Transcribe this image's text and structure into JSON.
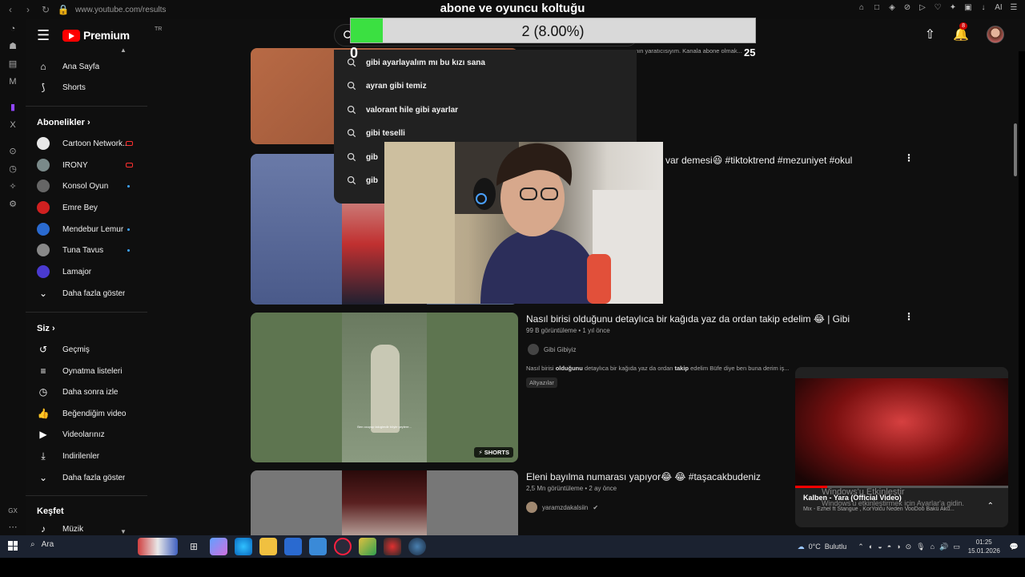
{
  "browser": {
    "url": "www.youtube.com/results",
    "back": "‹",
    "forward": "›",
    "reload": "↻",
    "ext_label": "AI"
  },
  "overlay": {
    "title": "abone ve oyuncu koltuğu",
    "goal_text": "2 (8.00%)",
    "goal_progress": 0.08,
    "goal_min": "0",
    "goal_max": "25"
  },
  "header": {
    "brand": "Premium",
    "country": "TR",
    "notification_count": "8"
  },
  "sidebar": {
    "main": [
      {
        "label": "Ana Sayfa",
        "icon": "home-icon"
      },
      {
        "label": "Shorts",
        "icon": "shorts-icon"
      }
    ],
    "subscriptions_heading": "Abonelikler",
    "subscriptions": [
      {
        "label": "Cartoon Network...",
        "color": "#e8e8e8",
        "indicator": "live"
      },
      {
        "label": "IRONY",
        "color": "#7a8a8a",
        "indicator": "live"
      },
      {
        "label": "Konsol Oyun",
        "color": "#666666",
        "indicator": "dot"
      },
      {
        "label": "Emre Bey",
        "color": "#d02020",
        "indicator": ""
      },
      {
        "label": "Mendebur Lemur",
        "color": "#2a6ad0",
        "indicator": "dot"
      },
      {
        "label": "Tuna Tavus",
        "color": "#888888",
        "indicator": "dot"
      },
      {
        "label": "Lamajor",
        "color": "#4a3ad0",
        "indicator": ""
      }
    ],
    "show_more": "Daha fazla göster",
    "you_heading": "Siz",
    "you": [
      {
        "label": "Geçmiş",
        "icon": "history-icon"
      },
      {
        "label": "Oynatma listeleri",
        "icon": "playlist-icon"
      },
      {
        "label": "Daha sonra izle",
        "icon": "clock-icon"
      },
      {
        "label": "Beğendiğim videolar",
        "icon": "thumbs-up-icon"
      },
      {
        "label": "Videolarınız",
        "icon": "your-videos-icon"
      },
      {
        "label": "İndirilenler",
        "icon": "download-icon"
      },
      {
        "label": "Daha fazla göster",
        "icon": "chevron-down-icon"
      }
    ],
    "explore_heading": "Keşfet",
    "explore": [
      {
        "label": "Müzik",
        "icon": "music-icon"
      }
    ]
  },
  "search": {
    "suggestions": [
      {
        "bold": "gibi ayarlayalım mı bu kızı sana",
        "thin": ""
      },
      {
        "bold": "ayran gibi temiz",
        "thin": ""
      },
      {
        "bold": "valorant hile gibi ayarlar",
        "thin": ""
      },
      {
        "bold": "gibi teselli",
        "thin": ""
      },
      {
        "bold": "gib",
        "thin": ""
      },
      {
        "bold": "gib",
        "thin": ""
      }
    ]
  },
  "results": {
    "top_partial_desc": "nın yaratıcısıyım. Kanala abone olmak...",
    "video1": {
      "title": "u var demesi😆 #tiktoktrend #mezuniyet #okul"
    },
    "video2": {
      "title": "Nasıl birisi olduğunu detaylıca bir kağıda yaz da ordan takip edelim 😂 | Gibi",
      "meta": "99 B görüntüleme • 1 yıl önce",
      "channel": "Gibi Gibiyiz",
      "desc_pre": "Nasıl birisi ",
      "desc_b1": "olduğunu",
      "desc_mid": " detaylıca bir kağıda yaz da ordan ",
      "desc_b2": "takip",
      "desc_post": " edelim Büfe diye ben buna derim iş...",
      "chip": "Altyazılar",
      "shorts": "SHORTS",
      "caption": "Ben ocuyup takıgimdir böyle şeylere..."
    },
    "video3": {
      "title": "Eleni bayılma numarası yapıyor😂 😂 #taşacakbudeniz",
      "meta": "2,5 Mn görüntüleme • 2 ay önce",
      "channel": "yaramzdakalsiin"
    }
  },
  "miniplayer": {
    "title": "Kalben - Yara (Official Video)",
    "subtitle": "Mix - Ezhel ft Stangue , KorYolcu Neden VooDoo Bakü Akü...",
    "progress": 0.15,
    "activation_title": "Windows'u Etkinleştir",
    "activation_sub": "Windows'u etkinleştirmek için Ayarlar'a gidin."
  },
  "taskbar": {
    "search_label": "Ara",
    "weather": "0°C",
    "weather_desc": "Bulutlu",
    "time": "01:25",
    "date": "15.01.2026"
  }
}
